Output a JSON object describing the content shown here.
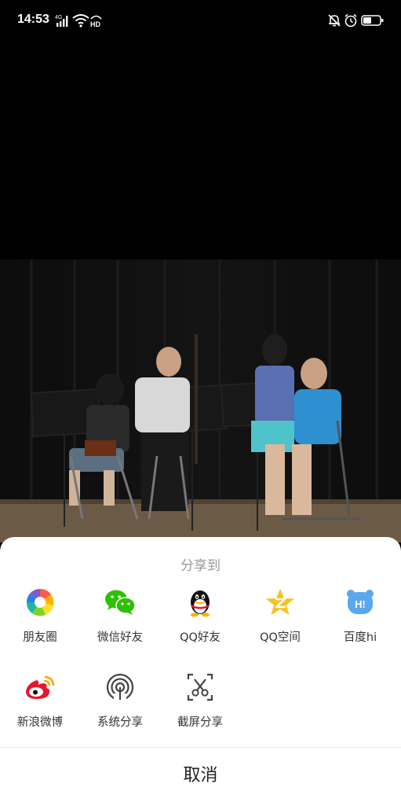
{
  "status_bar": {
    "time": "14:53",
    "signal_badge": "4G",
    "hd_badge": "HD",
    "icons": [
      "signal-icon",
      "wifi-icon",
      "hd-icon",
      "mute-bell-icon",
      "alarm-icon",
      "battery-icon"
    ]
  },
  "photo": {
    "description_icon": "concert-photo"
  },
  "share_sheet": {
    "title": "分享到",
    "row1": [
      {
        "label": "朋友圈",
        "icon": "moments-icon"
      },
      {
        "label": "微信好友",
        "icon": "wechat-icon"
      },
      {
        "label": "QQ好友",
        "icon": "qq-icon"
      },
      {
        "label": "QQ空间",
        "icon": "qzone-icon"
      },
      {
        "label": "百度hi",
        "icon": "baidu-hi-icon"
      }
    ],
    "row2": [
      {
        "label": "新浪微博",
        "icon": "weibo-icon"
      },
      {
        "label": "系统分享",
        "icon": "system-share-icon"
      },
      {
        "label": "截屏分享",
        "icon": "screenshot-share-icon"
      }
    ],
    "baidu_badge": "H!",
    "cancel": "取消"
  },
  "colors": {
    "sheet_bg": "#ffffff",
    "title": "#999999",
    "label": "#333333",
    "wechat_green": "#2dc100",
    "qzone_yellow": "#f7c21b",
    "baidu_blue": "#5aa7ee",
    "weibo_red": "#e6162d"
  }
}
